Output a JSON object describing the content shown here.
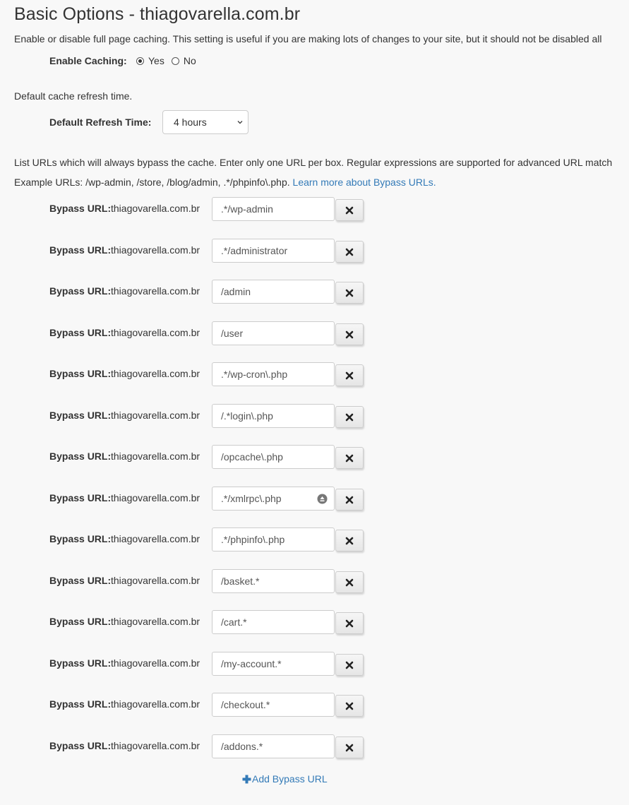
{
  "page_title": "Basic Options - thiagovarella.com.br",
  "caching": {
    "description": "Enable or disable full page caching. This setting is useful if you are making lots of changes to your site, but it should not be disabled all",
    "label": "Enable Caching:",
    "options": [
      {
        "label": "Yes",
        "checked": true
      },
      {
        "label": "No",
        "checked": false
      }
    ]
  },
  "refresh": {
    "description": "Default cache refresh time.",
    "label": "Default Refresh Time:",
    "selected": "4 hours"
  },
  "bypass": {
    "description_line1": "List URLs which will always bypass the cache. Enter only one URL per box. Regular expressions are supported for advanced URL match",
    "description_line2": "Example URLs: /wp-admin, /store, /blog/admin, .*/phpinfo\\.php.",
    "learn_more": "Learn more about Bypass URLs.",
    "row_label": "Bypass URL:",
    "domain": "thiagovarella.com.br",
    "urls": [
      ".*/wp-admin",
      ".*/administrator",
      "/admin",
      "/user",
      ".*/wp-cron\\.php",
      "/.*login\\.php",
      "/opcache\\.php",
      ".*/xmlrpc\\.php",
      ".*/phpinfo\\.php",
      "/basket.*",
      "/cart.*",
      "/my-account.*",
      "/checkout.*",
      "/addons.*"
    ],
    "add_label": "Add Bypass URL",
    "icons": {
      "remove": "times-icon",
      "add": "plus-icon",
      "autofill": "key-icon"
    }
  }
}
